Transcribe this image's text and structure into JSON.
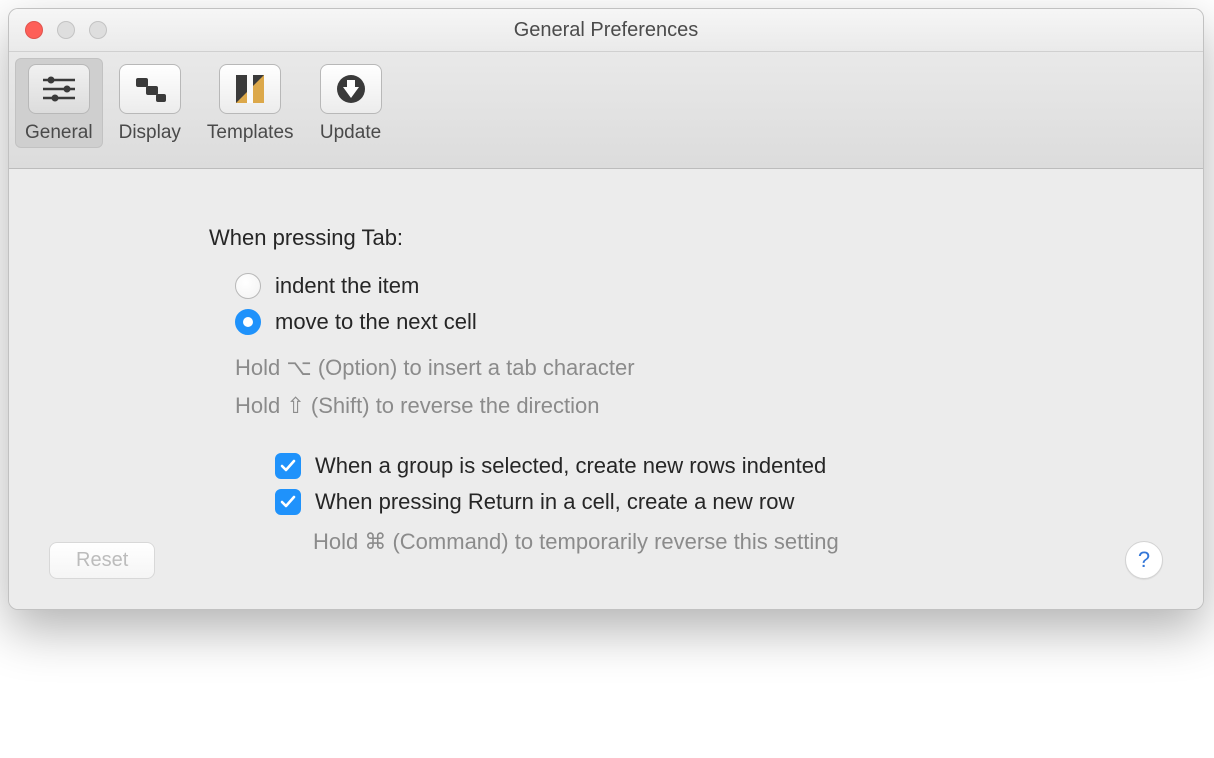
{
  "window": {
    "title": "General Preferences"
  },
  "toolbar": {
    "items": [
      {
        "label": "General",
        "icon": "sliders-icon",
        "active": true
      },
      {
        "label": "Display",
        "icon": "stairs-icon",
        "active": false
      },
      {
        "label": "Templates",
        "icon": "template-icon",
        "active": false
      },
      {
        "label": "Update",
        "icon": "download-icon",
        "active": false
      }
    ]
  },
  "content": {
    "tab_section_heading": "When pressing Tab:",
    "tab_radio_options": [
      {
        "label": "indent the item",
        "selected": false
      },
      {
        "label": "move to the next cell",
        "selected": true
      }
    ],
    "hint_option": "Hold ⌥ (Option) to insert a tab character",
    "hint_shift": "Hold ⇧ (Shift) to reverse the direction",
    "checkboxes": [
      {
        "label": "When a group is selected, create new rows indented",
        "checked": true
      },
      {
        "label": "When pressing Return in a cell, create a new row",
        "checked": true
      }
    ],
    "hint_command": "Hold ⌘ (Command) to temporarily reverse this setting"
  },
  "footer": {
    "reset_label": "Reset",
    "help_label": "?"
  }
}
